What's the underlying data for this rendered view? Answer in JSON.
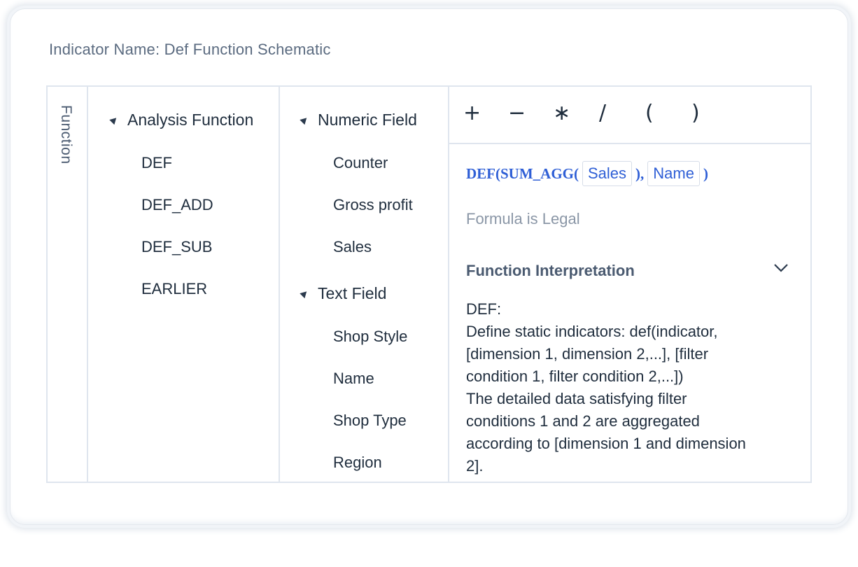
{
  "header": {
    "title": "Indicator Name: Def Function Schematic"
  },
  "sidebar": {
    "tab_label": "Function"
  },
  "functions": {
    "group_label": "Analysis Function",
    "items": [
      "DEF",
      "DEF_ADD",
      "DEF_SUB",
      "EARLIER"
    ]
  },
  "fields": {
    "numeric": {
      "label": "Numeric Field",
      "items": [
        "Counter",
        "Gross profit",
        "Sales"
      ]
    },
    "text": {
      "label": "Text Field",
      "items": [
        "Shop Style",
        "Name",
        "Shop Type",
        "Region"
      ]
    }
  },
  "operators": [
    "+",
    "−",
    "∗",
    "/",
    "(",
    ")"
  ],
  "formula": {
    "prefix": "DEF(SUM_AGG(",
    "arg1": "Sales",
    "middle": "),",
    "arg2": "Name",
    "suffix": ")"
  },
  "status": {
    "text": "Formula is Legal"
  },
  "interpretation": {
    "title": "Function Interpretation",
    "lines": [
      "DEF:",
      "Define static indicators: def(indicator,",
      "[dimension 1, dimension 2,...], [filter",
      "condition 1, filter condition 2,...])",
      "The detailed data satisfying filter",
      "conditions 1 and 2 are aggregated",
      "according to [dimension 1 and dimension",
      "2]."
    ]
  },
  "colors": {
    "accent": "#2f5fd6",
    "border": "#dfe5ee",
    "muted": "#8a96a6"
  }
}
